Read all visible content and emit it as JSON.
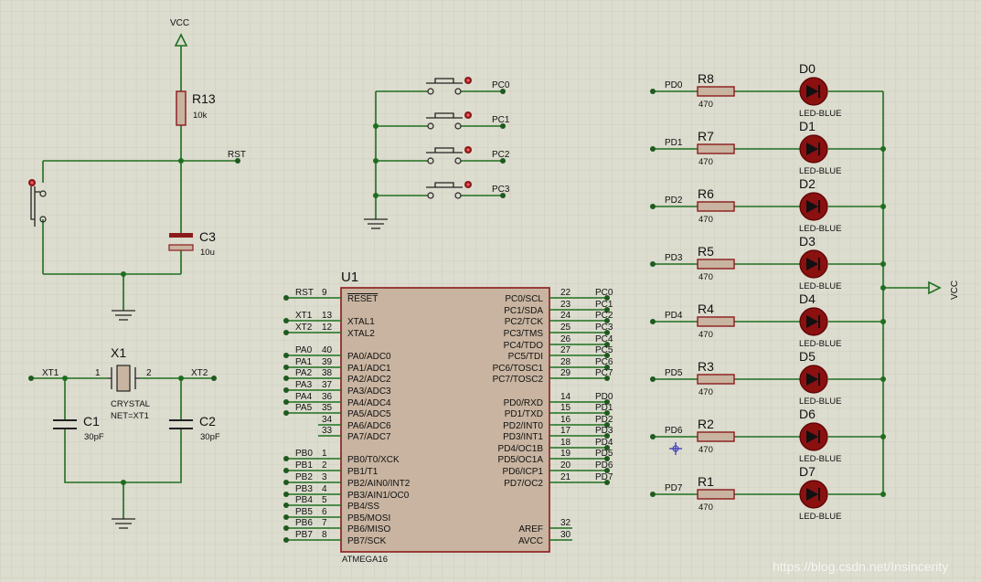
{
  "vcc_top": "VCC",
  "vcc_right": "VCC",
  "reset_circuit": {
    "r13": {
      "name": "R13",
      "value": "10k"
    },
    "c3": {
      "name": "C3",
      "value": "10u"
    },
    "rst_label": "RST"
  },
  "crystal_circuit": {
    "x1": {
      "name": "X1",
      "type": "CRYSTAL",
      "net": "NET=XT1",
      "pin1": "1",
      "pin2": "2"
    },
    "c1": {
      "name": "C1",
      "value": "30pF"
    },
    "c2": {
      "name": "C2",
      "value": "30pF"
    },
    "xt1": "XT1",
    "xt2": "XT2"
  },
  "buttons": {
    "labels": [
      "PC0",
      "PC1",
      "PC2",
      "PC3"
    ]
  },
  "mcu": {
    "name": "U1",
    "part": "ATMEGA16",
    "left_pins": [
      {
        "net": "RST",
        "num": "9",
        "name": "RESET"
      },
      {
        "net": "XT1",
        "num": "13",
        "name": "XTAL1"
      },
      {
        "net": "XT2",
        "num": "12",
        "name": "XTAL2"
      },
      {
        "net": "PA0",
        "num": "40",
        "name": "PA0/ADC0"
      },
      {
        "net": "PA1",
        "num": "39",
        "name": "PA1/ADC1"
      },
      {
        "net": "PA2",
        "num": "38",
        "name": "PA2/ADC2"
      },
      {
        "net": "PA3",
        "num": "37",
        "name": "PA3/ADC3"
      },
      {
        "net": "PA4",
        "num": "36",
        "name": "PA4/ADC4"
      },
      {
        "net": "PA5",
        "num": "35",
        "name": "PA5/ADC5"
      },
      {
        "net": "",
        "num": "34",
        "name": "PA6/ADC6"
      },
      {
        "net": "",
        "num": "33",
        "name": "PA7/ADC7"
      },
      {
        "net": "PB0",
        "num": "1",
        "name": "PB0/T0/XCK"
      },
      {
        "net": "PB1",
        "num": "2",
        "name": "PB1/T1"
      },
      {
        "net": "PB2",
        "num": "3",
        "name": "PB2/AIN0/INT2"
      },
      {
        "net": "PB3",
        "num": "4",
        "name": "PB3/AIN1/OC0"
      },
      {
        "net": "PB4",
        "num": "5",
        "name": "PB4/SS"
      },
      {
        "net": "PB5",
        "num": "6",
        "name": "PB5/MOSI"
      },
      {
        "net": "PB6",
        "num": "7",
        "name": "PB6/MISO"
      },
      {
        "net": "PB7",
        "num": "8",
        "name": "PB7/SCK"
      }
    ],
    "right_pins": [
      {
        "net": "PC0",
        "num": "22",
        "name": "PC0/SCL"
      },
      {
        "net": "PC1",
        "num": "23",
        "name": "PC1/SDA"
      },
      {
        "net": "PC2",
        "num": "24",
        "name": "PC2/TCK"
      },
      {
        "net": "PC3",
        "num": "25",
        "name": "PC3/TMS"
      },
      {
        "net": "PC4",
        "num": "26",
        "name": "PC4/TDO"
      },
      {
        "net": "PC5",
        "num": "27",
        "name": "PC5/TDI"
      },
      {
        "net": "PC6",
        "num": "28",
        "name": "PC6/TOSC1"
      },
      {
        "net": "PC7",
        "num": "29",
        "name": "PC7/TOSC2"
      },
      {
        "net": "PD0",
        "num": "14",
        "name": "PD0/RXD"
      },
      {
        "net": "PD1",
        "num": "15",
        "name": "PD1/TXD"
      },
      {
        "net": "PD2",
        "num": "16",
        "name": "PD2/INT0"
      },
      {
        "net": "PD3",
        "num": "17",
        "name": "PD3/INT1"
      },
      {
        "net": "PD4",
        "num": "18",
        "name": "PD4/OC1B"
      },
      {
        "net": "PD5",
        "num": "19",
        "name": "PD5/OC1A"
      },
      {
        "net": "PD6",
        "num": "20",
        "name": "PD6/ICP1"
      },
      {
        "net": "PD7",
        "num": "21",
        "name": "PD7/OC2"
      },
      {
        "net": "",
        "num": "32",
        "name": "AREF"
      },
      {
        "net": "",
        "num": "30",
        "name": "AVCC"
      }
    ]
  },
  "leds": [
    {
      "net": "PD0",
      "res": "R8",
      "val": "470",
      "led": "D0",
      "type": "LED-BLUE"
    },
    {
      "net": "PD1",
      "res": "R7",
      "val": "470",
      "led": "D1",
      "type": "LED-BLUE"
    },
    {
      "net": "PD2",
      "res": "R6",
      "val": "470",
      "led": "D2",
      "type": "LED-BLUE"
    },
    {
      "net": "PD3",
      "res": "R5",
      "val": "470",
      "led": "D3",
      "type": "LED-BLUE"
    },
    {
      "net": "PD4",
      "res": "R4",
      "val": "470",
      "led": "D4",
      "type": "LED-BLUE"
    },
    {
      "net": "PD5",
      "res": "R3",
      "val": "470",
      "led": "D5",
      "type": "LED-BLUE"
    },
    {
      "net": "PD6",
      "res": "R2",
      "val": "470",
      "led": "D6",
      "type": "LED-BLUE"
    },
    {
      "net": "PD7",
      "res": "R1",
      "val": "470",
      "led": "D7",
      "type": "LED-BLUE"
    }
  ],
  "watermark": "https://blog.csdn.net/Insincerity",
  "colors": {
    "background": "#dcdccf",
    "wire": "#1e6e1e",
    "chip_fill": "#c8b4a0",
    "chip_border": "#8b1a1a",
    "led_fill": "#8b1010",
    "resistor_fill": "#c8b4a0"
  }
}
